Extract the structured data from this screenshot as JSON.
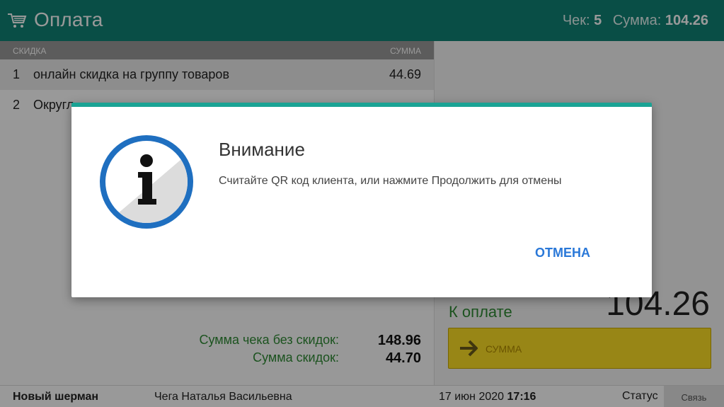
{
  "header": {
    "icon": "cart-icon",
    "title": "Оплата",
    "check_label": "Чек:",
    "check_number": "5",
    "sum_label": "Сумма:",
    "sum_value": "104.26"
  },
  "table": {
    "col_discount": "СКИДКА",
    "col_sum": "СУММА",
    "rows": [
      {
        "n": "1",
        "name": "онлайн скидка на группу товаров",
        "sum": "44.69"
      },
      {
        "n": "2",
        "name": "Округл",
        "sum": ""
      }
    ]
  },
  "totals": {
    "no_discount_label": "Сумма чека без скидок:",
    "no_discount_value": "148.96",
    "discount_label": "Сумма скидок:",
    "discount_value": "44.70"
  },
  "payment": {
    "label": "К оплате",
    "amount": "104.26",
    "button_label": "СУММА",
    "button_icon": "arrow-right-icon"
  },
  "footer": {
    "store": "Новый шерман",
    "cashier": "Чега Наталья Васильевна",
    "date": "17 июн 2020",
    "time": "17:16",
    "status": "Статус",
    "connection": "Связь"
  },
  "dialog": {
    "icon": "info-icon",
    "title": "Внимание",
    "message": "Считайте QR код клиента, или нажмите Продолжить для отмены",
    "cancel_label": "ОТМЕНА"
  },
  "colors": {
    "header_bg": "#0f8276",
    "accent": "#1aa394",
    "total_green": "#2f8a35",
    "pay_button": "#fde026",
    "link_blue": "#2a78d8"
  }
}
